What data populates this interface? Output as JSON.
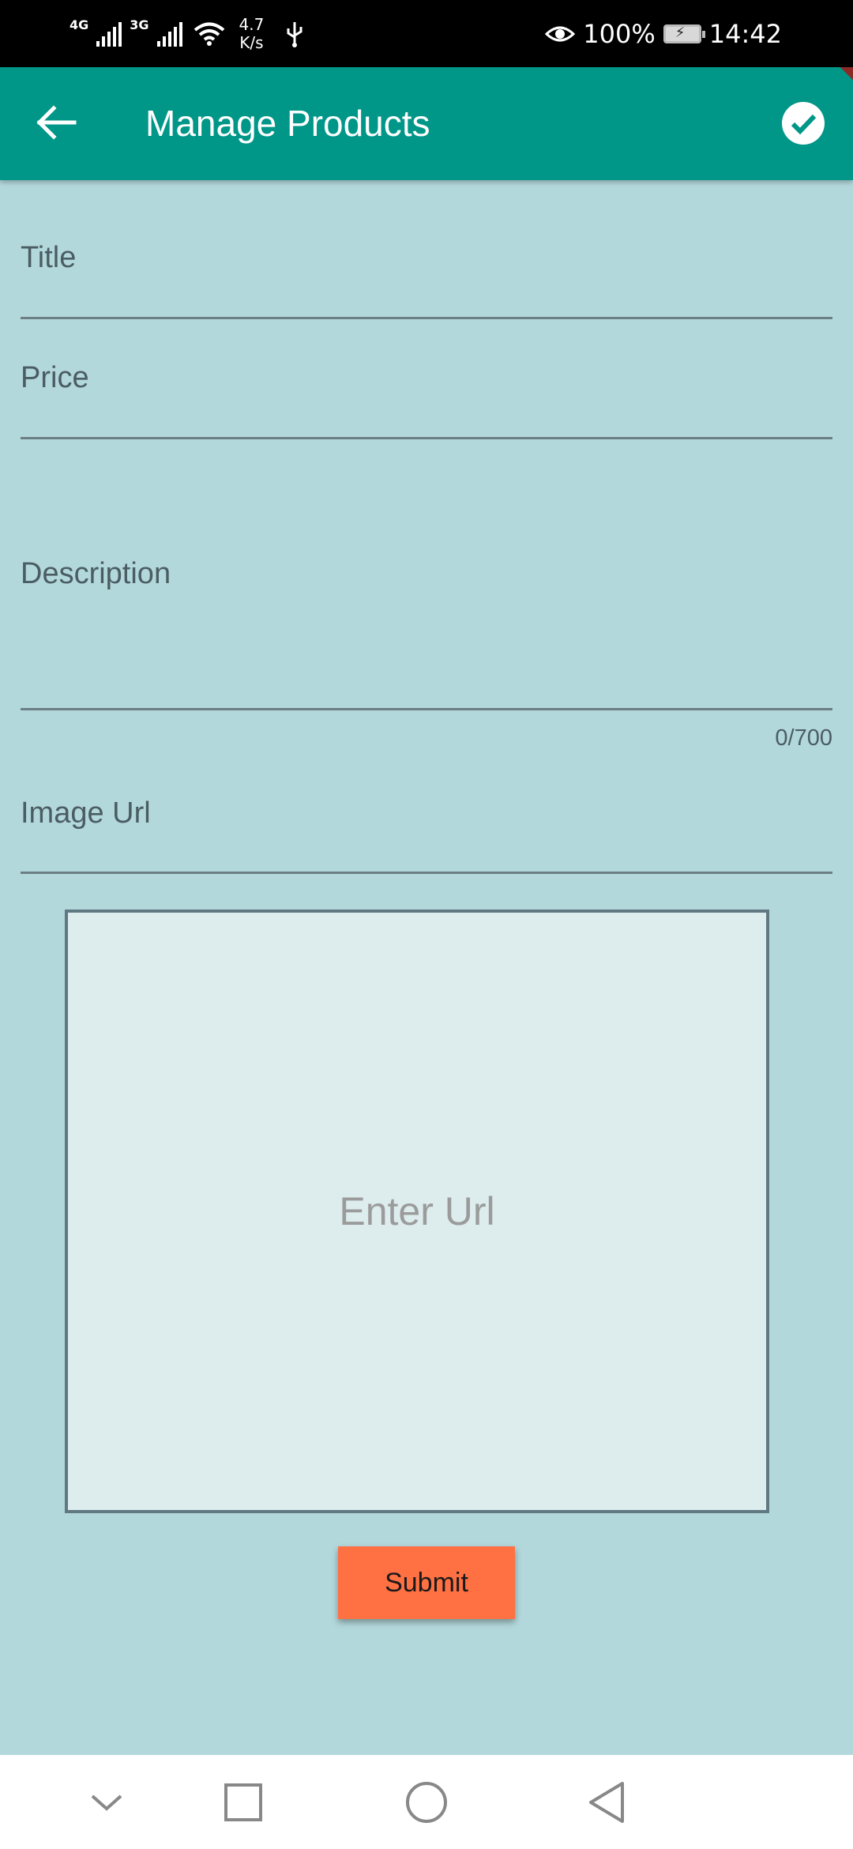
{
  "status_bar": {
    "network1": "4G",
    "network2": "3G",
    "speed_value": "4.7",
    "speed_unit": "K/s",
    "battery_percent": "100%",
    "time": "14:42"
  },
  "app_bar": {
    "title": "Manage Products",
    "back_icon": "arrow-back-icon",
    "action_icon": "check-circle-icon",
    "color": "#009688"
  },
  "form": {
    "title_label": "Title",
    "price_label": "Price",
    "description_label": "Description",
    "description_counter": "0/700",
    "image_url_label": "Image Url",
    "preview_placeholder": "Enter Url",
    "submit_label": "Submit",
    "submit_color": "#ff7043"
  },
  "nav_bar": {
    "icons": [
      "chevron-down-icon",
      "recents-square-icon",
      "home-circle-icon",
      "back-triangle-icon"
    ]
  }
}
